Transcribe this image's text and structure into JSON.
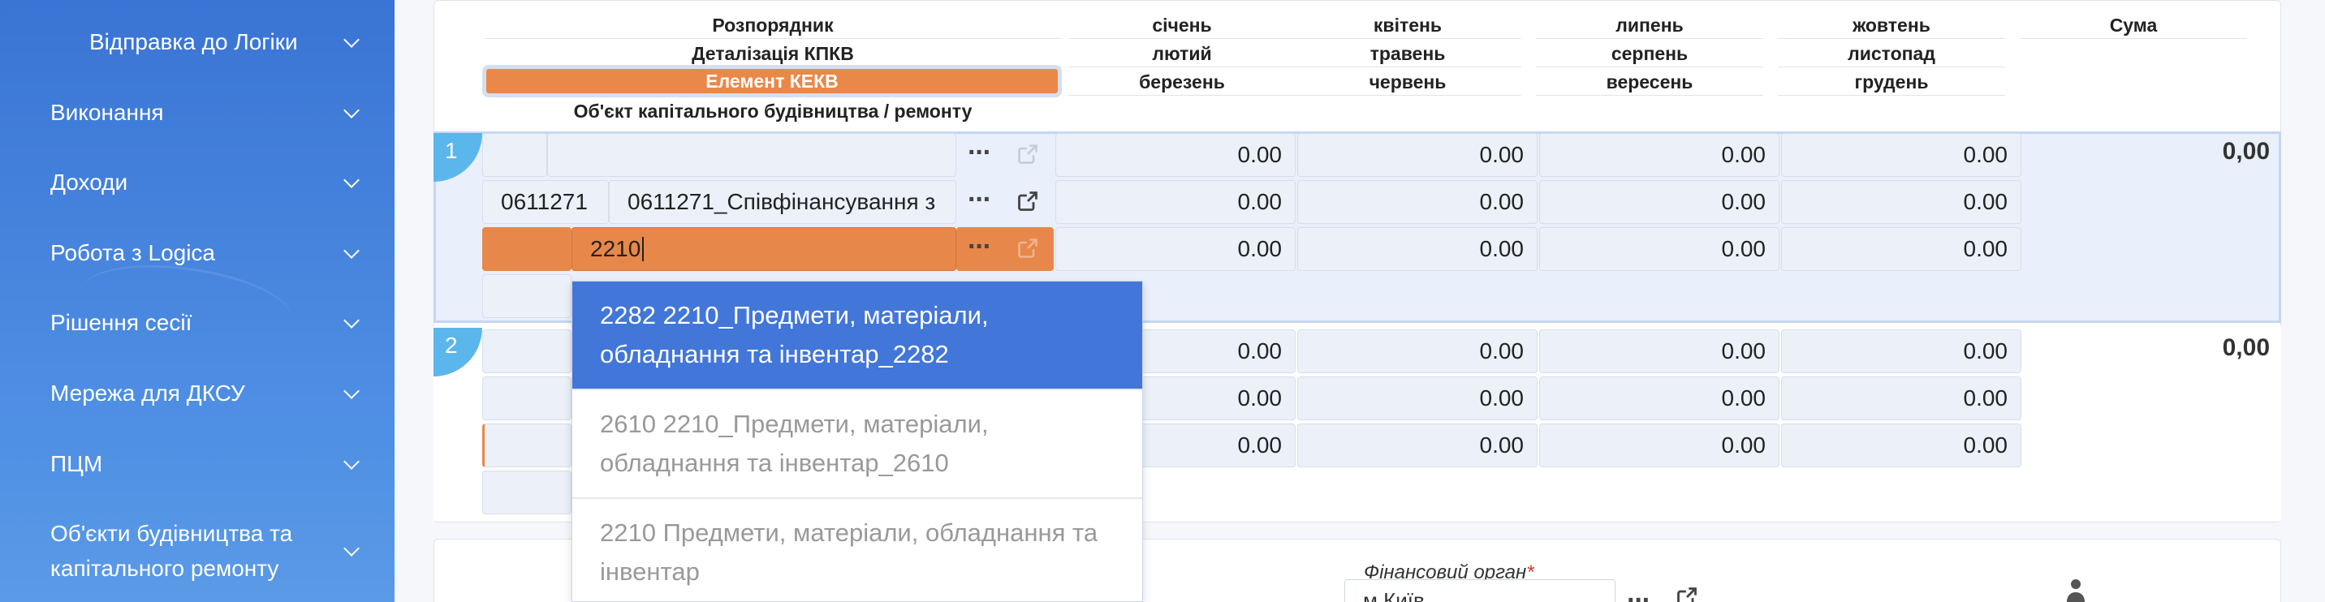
{
  "sidebar": {
    "items": [
      {
        "label": "Відправка до Логіки",
        "sub": true
      },
      {
        "label": "Виконання"
      },
      {
        "label": "Доходи"
      },
      {
        "label": "Робота з Logica"
      },
      {
        "label": "Рішення сесії"
      },
      {
        "label": "Мережа для ДКСУ"
      },
      {
        "label": "ПЦМ"
      },
      {
        "label": "Об'єкти будівництва та",
        "label2": "капітального ремонту"
      }
    ]
  },
  "table": {
    "headers": {
      "col1": [
        "Розпорядник",
        "Деталізація КПКВ",
        "Елемент КЕКВ",
        "Об'єкт капітального будівництва / ремонту"
      ],
      "q1": [
        "січень",
        "лютий",
        "березень"
      ],
      "q2": [
        "квітень",
        "травень",
        "червень"
      ],
      "q3": [
        "липень",
        "серпень",
        "вересень"
      ],
      "q4": [
        "жовтень",
        "листопад",
        "грудень"
      ],
      "sum": "Сума"
    },
    "rows": [
      {
        "number": "1",
        "kpkv_code": "0611271",
        "kpkv_name": "0611271_Співфінансування з",
        "kekv_input": "2210",
        "months": [
          "0.00",
          "0.00",
          "0.00",
          "0.00",
          "0.00",
          "0.00",
          "0.00",
          "0.00",
          "0.00",
          "0.00",
          "0.00",
          "0.00"
        ],
        "sum": "0,00"
      },
      {
        "number": "2",
        "months": [
          "0.00",
          "0.00",
          "0.00",
          "0.00",
          "0.00",
          "0.00",
          "0.00",
          "0.00",
          "0.00",
          "0.00",
          "0.00",
          "0.00"
        ],
        "sum": "0,00"
      }
    ]
  },
  "dropdown": {
    "options": [
      {
        "line1": "2282 2210_Предмети, матеріали,",
        "line2": "обладнання та інвентар_2282",
        "active": true
      },
      {
        "line1": "2610 2210_Предмети, матеріали,",
        "line2": "обладнання та інвентар_2610",
        "active": false
      },
      {
        "line1": "2210 Предмети, матеріали, обладнання та",
        "line2": "інвентар",
        "active": false
      }
    ]
  },
  "bottom": {
    "fin_label": "Фінансовий орган",
    "fin_required": "*",
    "fin_value": "м.Київ"
  },
  "colors": {
    "accent": "#4276d8",
    "kekv": "#e8874a",
    "sidebar": "#3a74d4"
  }
}
